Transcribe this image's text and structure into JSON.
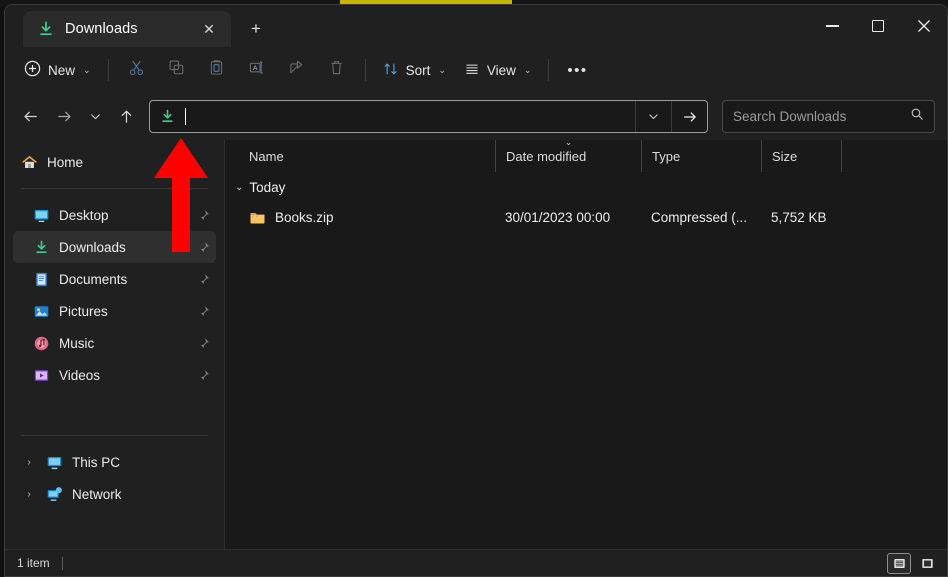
{
  "window": {
    "title": "Downloads",
    "tab_icon": "downloads-icon",
    "close_tab_label": "✕",
    "new_tab_label": "+",
    "minimize_label": "–",
    "maximize_label": "□",
    "close_label": "✕"
  },
  "toolbar": {
    "new_label": "New",
    "new_chevron": "⌄",
    "sort_label": "Sort",
    "sort_chevron": "⌄",
    "view_label": "View",
    "view_chevron": "⌄",
    "more_label": "•••",
    "icons": [
      {
        "name": "cut-icon",
        "enabled": false
      },
      {
        "name": "copy-icon",
        "enabled": false
      },
      {
        "name": "paste-icon",
        "enabled": false
      },
      {
        "name": "rename-icon",
        "enabled": false
      },
      {
        "name": "share-icon",
        "enabled": false
      },
      {
        "name": "delete-icon",
        "enabled": false
      }
    ]
  },
  "navbar": {
    "back_label": "←",
    "forward_label": "→",
    "recent_label": "⌄",
    "up_label": "↑",
    "address_icon": "downloads-icon",
    "address_value": "",
    "address_placeholder": "",
    "address_dropdown_label": "⌄",
    "address_go_label": "→",
    "search_placeholder": "Search Downloads",
    "search_value": "",
    "search_icon": "search-icon"
  },
  "sidebar": {
    "home": {
      "label": "Home",
      "icon": "home-icon"
    },
    "quick_access": [
      {
        "label": "Desktop",
        "icon": "desktop-icon",
        "pinned": true,
        "selected": false
      },
      {
        "label": "Downloads",
        "icon": "downloads-icon",
        "pinned": true,
        "selected": true
      },
      {
        "label": "Documents",
        "icon": "documents-icon",
        "pinned": true,
        "selected": false
      },
      {
        "label": "Pictures",
        "icon": "pictures-icon",
        "pinned": true,
        "selected": false
      },
      {
        "label": "Music",
        "icon": "music-icon",
        "pinned": true,
        "selected": false
      },
      {
        "label": "Videos",
        "icon": "videos-icon",
        "pinned": true,
        "selected": false
      }
    ],
    "tree": [
      {
        "label": "This PC",
        "icon": "this-pc-icon",
        "chevron": "›"
      },
      {
        "label": "Network",
        "icon": "network-icon",
        "chevron": "›"
      }
    ]
  },
  "filelist": {
    "columns": [
      {
        "key": "name",
        "label": "Name",
        "sorted": false
      },
      {
        "key": "date",
        "label": "Date modified",
        "sorted": true
      },
      {
        "key": "type",
        "label": "Type",
        "sorted": false
      },
      {
        "key": "size",
        "label": "Size",
        "sorted": false
      }
    ],
    "sort_mark": "⌄",
    "groups": [
      {
        "label": "Today",
        "chevron": "⌄",
        "rows": [
          {
            "name": "Books.zip",
            "date": "30/01/2023 00:00",
            "type": "Compressed (...",
            "size": "5,752 KB",
            "icon": "zip-file-icon"
          }
        ]
      }
    ]
  },
  "statusbar": {
    "item_count": "1 item",
    "details_view_label": "details-view",
    "large_icons_view_label": "large-icons-view"
  },
  "annotation": {
    "type": "arrow",
    "direction": "up",
    "color": "#FF0000",
    "points_at": "address-bar"
  },
  "colors": {
    "window_bg": "#202020",
    "content_bg": "#191919",
    "tab_active": "#2b2b2b",
    "selection": "#2f2f2f",
    "accent_green": "#3fcf8e",
    "annotation_red": "#FF0000"
  }
}
